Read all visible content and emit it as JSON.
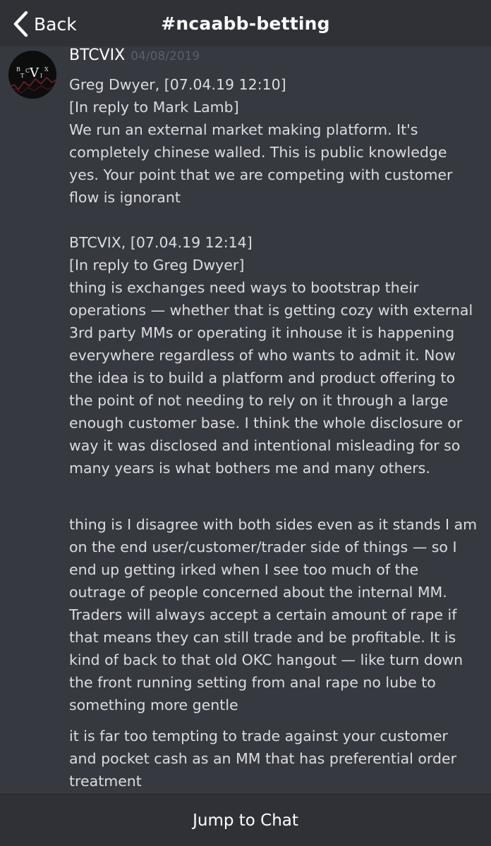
{
  "header": {
    "back_label": "Back",
    "channel_title": "#ncaabb-betting"
  },
  "message": {
    "author": "BTCVIX",
    "timestamp": "04/08/2019",
    "avatar_letters": {
      "b": "B",
      "t": "T",
      "c": "C",
      "v": "V",
      "i": "I",
      "x": "X"
    },
    "paragraphs": [
      "Greg Dwyer, [07.04.19 12:10]\n[In reply to Mark Lamb]\nWe run an external market making platform. It's completely chinese walled. This is public knowledge yes. Your point that we are competing with customer flow is ignorant\n\nBTCVIX, [07.04.19 12:14]\n[In reply to Greg Dwyer]\nthing is exchanges need ways to bootstrap their operations — whether that is getting cozy with external 3rd party MMs or operating it inhouse it is happening everywhere regardless of who wants to admit it. Now the idea is to build a platform and product offering to the point of not needing to rely on it through a large enough customer base. I think the whole disclosure or way it was disclosed and intentional misleading for so many years is what bothers me and many others.",
      "thing is I disagree with both sides even as it stands I am on the end user/customer/trader side of things — so I end up getting irked when I see too much of the outrage of people concerned about the internal MM. Traders will always accept a certain amount of rape if that means they can still trade and be profitable. It is kind of back to that old OKC hangout — like turn down the front running setting from anal rape no lube to something more gentle",
      "it is far too tempting to trade against your customer and pocket cash as an MM that has preferential order treatment"
    ]
  },
  "footer": {
    "jump_label": "Jump to Chat"
  },
  "colors": {
    "background": "#36393f",
    "header_bg": "#2f3136",
    "text": "#dcddde",
    "timestamp": "#5c5f66"
  }
}
